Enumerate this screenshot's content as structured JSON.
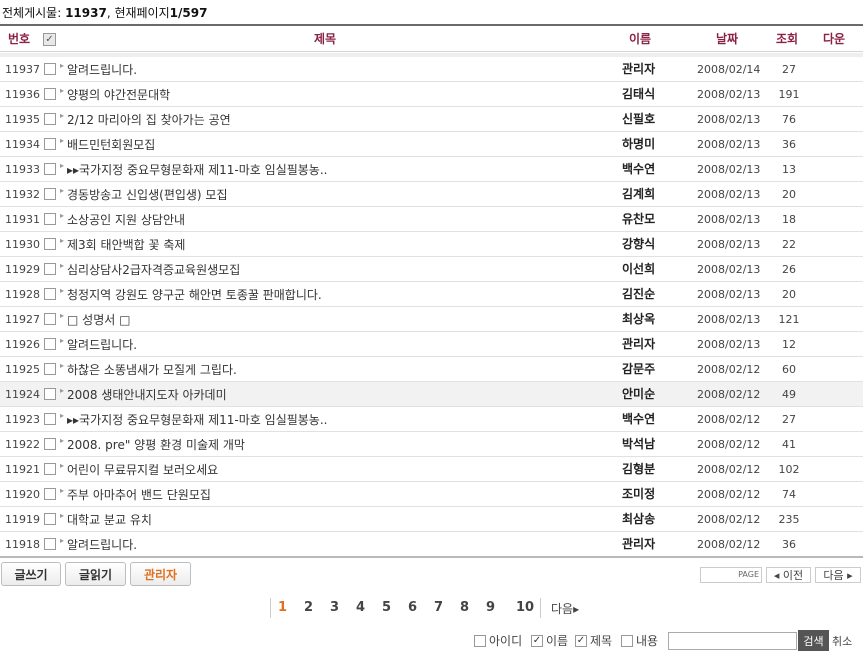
{
  "summary": {
    "label": "전체게시물: ",
    "count": "11937",
    "page_label": ",  현재페이지",
    "page": "1/597"
  },
  "columns": {
    "num": "번호",
    "title": "제목",
    "name": "이름",
    "date": "날짜",
    "views": "조회",
    "down": "다운"
  },
  "rows": [
    {
      "num": "11937",
      "title": "알려드립니다.",
      "name": "관리자",
      "date": "2008/02/14",
      "views": "27"
    },
    {
      "num": "11936",
      "title": "양평의 야간전문대학",
      "name": "김태식",
      "date": "2008/02/13",
      "views": "191"
    },
    {
      "num": "11935",
      "title": "2/12 마리아의 집 찾아가는 공연",
      "name": "신필호",
      "date": "2008/02/13",
      "views": "76"
    },
    {
      "num": "11934",
      "title": "배드민턴회원모집",
      "name": "하명미",
      "date": "2008/02/13",
      "views": "36"
    },
    {
      "num": "11933",
      "title": "▸▸국가지정 중요무형문화재 제11-마호 임실필봉농..",
      "name": "백수연",
      "date": "2008/02/13",
      "views": "13"
    },
    {
      "num": "11932",
      "title": "경동방송고 신입생(편입생) 모집",
      "name": "김계희",
      "date": "2008/02/13",
      "views": "20"
    },
    {
      "num": "11931",
      "title": "소상공인 지원 상담안내",
      "name": "유찬모",
      "date": "2008/02/13",
      "views": "18"
    },
    {
      "num": "11930",
      "title": "제3회 태안백합 꽃 축제",
      "name": "강향식",
      "date": "2008/02/13",
      "views": "22"
    },
    {
      "num": "11929",
      "title": "심리상담사2급자격증교육원생모집",
      "name": "이선희",
      "date": "2008/02/13",
      "views": "26"
    },
    {
      "num": "11928",
      "title": "청정지역 강원도 양구군 해안면 토종꿀 판매합니다.",
      "name": "김진순",
      "date": "2008/02/13",
      "views": "20"
    },
    {
      "num": "11927",
      "title": "□ 성명서 □",
      "name": "최상옥",
      "date": "2008/02/13",
      "views": "121"
    },
    {
      "num": "11926",
      "title": "알려드립니다.",
      "name": "관리자",
      "date": "2008/02/13",
      "views": "12"
    },
    {
      "num": "11925",
      "title": "하찮은 소똥냄새가 모질게 그립다.",
      "name": "감문주",
      "date": "2008/02/12",
      "views": "60"
    },
    {
      "num": "11924",
      "title": "2008 생태안내지도자 아카데미",
      "name": "안미순",
      "date": "2008/02/12",
      "views": "49"
    },
    {
      "num": "11923",
      "title": "▸▸국가지정 중요무형문화재 제11-마호 임실필봉농..",
      "name": "백수연",
      "date": "2008/02/12",
      "views": "27"
    },
    {
      "num": "11922",
      "title": "2008. pre\" 양평 환경 미술제 개막",
      "name": "박석남",
      "date": "2008/02/12",
      "views": "41"
    },
    {
      "num": "11921",
      "title": "어린이 무료뮤지컬 보러오세요",
      "name": "김형분",
      "date": "2008/02/12",
      "views": "102"
    },
    {
      "num": "11920",
      "title": "주부 아마추어 밴드 단원모집",
      "name": "조미정",
      "date": "2008/02/12",
      "views": "74"
    },
    {
      "num": "11919",
      "title": "대학교 분교 유치",
      "name": "최삼송",
      "date": "2008/02/12",
      "views": "235"
    },
    {
      "num": "11918",
      "title": "알려드립니다.",
      "name": "관리자",
      "date": "2008/02/12",
      "views": "36"
    }
  ],
  "buttons": {
    "write": "글쓰기",
    "read": "글읽기",
    "admin": "관리자"
  },
  "page_nav": {
    "page_label": "PAGE",
    "prev": "◂ 이전",
    "next": "다음 ▸"
  },
  "pagination": {
    "pages": [
      "1",
      "2",
      "3",
      "4",
      "5",
      "6",
      "7",
      "8",
      "9",
      "10"
    ],
    "current": "1",
    "next": "다음▸"
  },
  "search": {
    "options": [
      {
        "label": "아이디",
        "checked": false
      },
      {
        "label": "이름",
        "checked": true
      },
      {
        "label": "제목",
        "checked": true
      },
      {
        "label": "내용",
        "checked": false
      }
    ],
    "button": "검색",
    "cancel": "취소",
    "value": ""
  },
  "colors": {
    "header_text": "#8a2244",
    "accent": "#e07020"
  }
}
